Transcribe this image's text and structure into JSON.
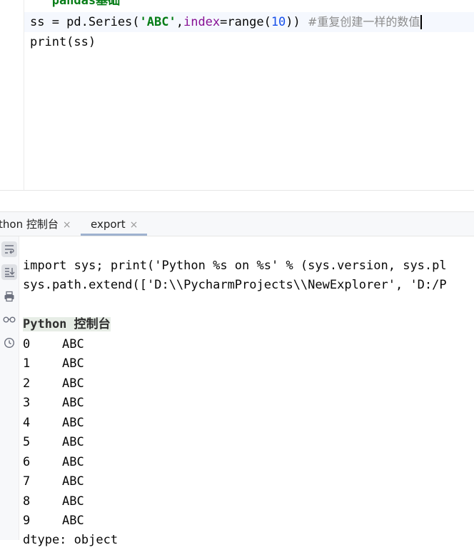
{
  "editor": {
    "line_top_partial": "'''pandas基础'''",
    "line_current": {
      "prefix": "ss = pd.Series(",
      "str": "'ABC'",
      "comma": ",",
      "kw": "index",
      "eq": "=range(",
      "num": "10",
      "close": "))",
      "comment": "  #重复创建一样的数值"
    },
    "line_print": "print(ss)"
  },
  "tabs": [
    {
      "label": "thon 控制台",
      "close": "×"
    },
    {
      "label": "export",
      "close": "×"
    }
  ],
  "console": {
    "cmd1": "import sys; print('Python %s on %s' % (sys.version, sys.pl",
    "cmd2": "sys.path.extend(['D:\\\\PycharmProjects\\\\NewExplorer', 'D:/P",
    "banner": "Python 控制台",
    "rows": [
      {
        "index": "0",
        "value": "ABC"
      },
      {
        "index": "1",
        "value": "ABC"
      },
      {
        "index": "2",
        "value": "ABC"
      },
      {
        "index": "3",
        "value": "ABC"
      },
      {
        "index": "4",
        "value": "ABC"
      },
      {
        "index": "5",
        "value": "ABC"
      },
      {
        "index": "6",
        "value": "ABC"
      },
      {
        "index": "7",
        "value": "ABC"
      },
      {
        "index": "8",
        "value": "ABC"
      },
      {
        "index": "9",
        "value": "ABC"
      }
    ],
    "dtype": "dtype: object"
  },
  "tools": [
    "soft-wrap-icon",
    "scroll-to-end-icon",
    "print-icon",
    "glasses-icon",
    "history-icon"
  ]
}
